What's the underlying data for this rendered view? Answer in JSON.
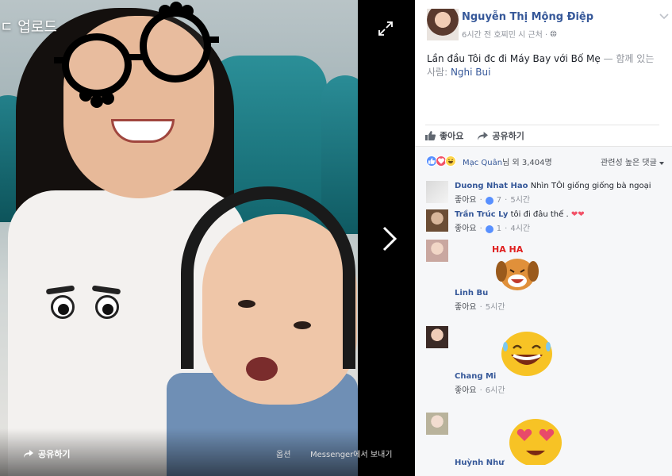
{
  "viewer": {
    "upload_label": "ㄷ 업로드",
    "share_label": "공유하기",
    "options_label": "옵션",
    "messenger_label": "Messenger에서 보내기"
  },
  "post": {
    "author": "Nguyễn Thị Mộng Điệp",
    "meta": "6시간 전 호찌민 시 근처 ·",
    "text_main": "Lần đầu Tôi đc đi Máy Bay với Bố Mẹ",
    "text_with": " — 함께 있는 사람: ",
    "tagged": "Nghi Bui"
  },
  "actions": {
    "like": "좋아요",
    "share": "공유하기"
  },
  "reactions": {
    "names": "Mạc Quân",
    "others": "님 외 3,404명",
    "sort": "관련성 높은 댓글"
  },
  "comments": [
    {
      "name": "Duong Nhat Hao",
      "text": "Nhìn TÔI giống giống bà ngoại",
      "like": "좋아요",
      "likes": "7",
      "time": "5시간"
    },
    {
      "name": "Trần Trúc Ly",
      "text": "tôi đi đâu thế .",
      "like": "좋아요",
      "likes": "1",
      "time": "4시간"
    },
    {
      "name": "Linh Bu",
      "text": "",
      "like": "좋아요",
      "time": "5시간",
      "sticker_text": "HA HA"
    },
    {
      "name": "Chang Mi",
      "text": "",
      "like": "좋아요",
      "time": "6시간"
    },
    {
      "name": "Huỳnh Như",
      "text": ""
    }
  ],
  "colors": {
    "link": "#365899",
    "muted": "#90949c",
    "like_blue": "#5890ff",
    "love_red": "#f25268"
  }
}
